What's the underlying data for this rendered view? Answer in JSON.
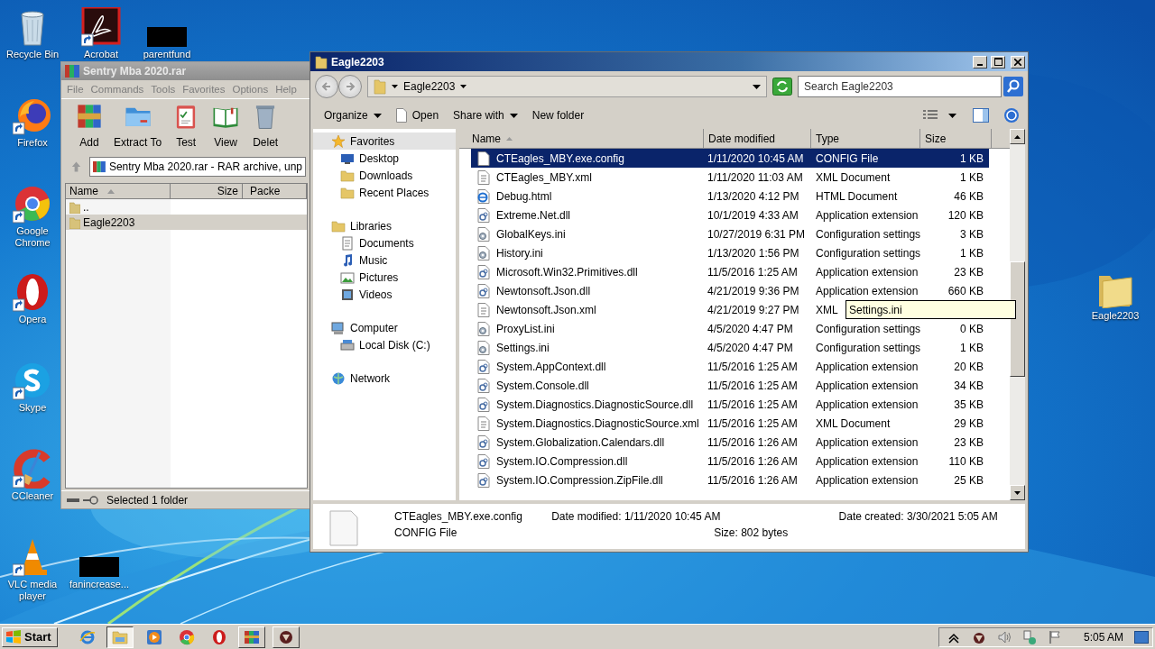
{
  "desktop": {
    "icons": [
      {
        "label": "Recycle Bin",
        "kind": "recycle",
        "shortcut": false
      },
      {
        "label": "Acrobat",
        "kind": "acrobat",
        "shortcut": true
      },
      {
        "label": "parentfund",
        "kind": "redacted",
        "shortcut": false
      },
      {
        "label": "Firefox",
        "kind": "firefox",
        "shortcut": true
      },
      {
        "label": "Google Chrome",
        "kind": "chrome",
        "shortcut": true
      },
      {
        "label": "Opera",
        "kind": "opera",
        "shortcut": true
      },
      {
        "label": "Skype",
        "kind": "skype",
        "shortcut": true
      },
      {
        "label": "CCleaner",
        "kind": "ccleaner",
        "shortcut": true
      },
      {
        "label": "VLC media player",
        "kind": "vlc",
        "shortcut": true
      },
      {
        "label": "fanincrease...",
        "kind": "redacted",
        "shortcut": false
      },
      {
        "label": "Eagle2203",
        "kind": "folder",
        "shortcut": false
      }
    ]
  },
  "winrar": {
    "title": "Sentry Mba 2020.rar",
    "menu": [
      "File",
      "Commands",
      "Tools",
      "Favorites",
      "Options",
      "Help"
    ],
    "toolbar": [
      {
        "label": "Add",
        "kind": "add"
      },
      {
        "label": "Extract To",
        "kind": "extract"
      },
      {
        "label": "Test",
        "kind": "test"
      },
      {
        "label": "View",
        "kind": "view"
      },
      {
        "label": "Delet",
        "kind": "delete"
      }
    ],
    "address": "Sentry Mba 2020.rar - RAR archive, unp",
    "columns": [
      {
        "label": "Name",
        "sorted": true
      },
      {
        "label": "Size",
        "sorted": false
      },
      {
        "label": "Packe",
        "sorted": false
      }
    ],
    "rows": [
      {
        "name": "..",
        "selected": false
      },
      {
        "name": "Eagle2203",
        "selected": true
      }
    ],
    "status": "Selected 1 folder"
  },
  "explorer": {
    "title": "Eagle2203",
    "breadcrumb": "Eagle2203",
    "search": {
      "placeholder": "Search Eagle2203"
    },
    "commands": [
      {
        "label": "Organize",
        "kind": "menu"
      },
      {
        "label": "Open",
        "kind": "icon"
      },
      {
        "label": "Share with",
        "kind": "menu"
      },
      {
        "label": "New folder",
        "kind": "plain"
      }
    ],
    "nav": [
      {
        "label": "Favorites",
        "kind": "star",
        "selected": true,
        "children": [
          {
            "label": "Desktop",
            "kind": "desktop",
            "selected": false
          },
          {
            "label": "Downloads",
            "kind": "downloads",
            "selected": false
          },
          {
            "label": "Recent Places",
            "kind": "recent",
            "selected": false
          }
        ]
      },
      {
        "label": "Libraries",
        "kind": "libraries",
        "selected": false,
        "children": [
          {
            "label": "Documents",
            "kind": "documents",
            "selected": false
          },
          {
            "label": "Music",
            "kind": "music",
            "selected": false
          },
          {
            "label": "Pictures",
            "kind": "pictures",
            "selected": false
          },
          {
            "label": "Videos",
            "kind": "videos",
            "selected": false
          }
        ]
      },
      {
        "label": "Computer",
        "kind": "computer",
        "selected": false,
        "children": [
          {
            "label": "Local Disk (C:)",
            "kind": "disk",
            "selected": false
          }
        ]
      },
      {
        "label": "Network",
        "kind": "network",
        "selected": false
      }
    ],
    "columns": [
      {
        "label": "Name",
        "sorted": true
      },
      {
        "label": "Date modified",
        "sorted": false
      },
      {
        "label": "Type",
        "sorted": false
      },
      {
        "label": "Size",
        "sorted": false
      }
    ],
    "rows": [
      {
        "name": "CTEagles_MBY.exe.config",
        "date": "1/11/2020 10:45 AM",
        "type": "CONFIG File",
        "size": "1 KB",
        "kind": "config",
        "selected": true
      },
      {
        "name": "CTEagles_MBY.xml",
        "date": "1/11/2020 11:03 AM",
        "type": "XML Document",
        "size": "1 KB",
        "kind": "xml",
        "selected": false
      },
      {
        "name": "Debug.html",
        "date": "1/13/2020 4:12 PM",
        "type": "HTML Document",
        "size": "46 KB",
        "kind": "html",
        "selected": false
      },
      {
        "name": "Extreme.Net.dll",
        "date": "10/1/2019 4:33 AM",
        "type": "Application extension",
        "size": "120 KB",
        "kind": "dll",
        "selected": false
      },
      {
        "name": "GlobalKeys.ini",
        "date": "10/27/2019 6:31 PM",
        "type": "Configuration settings",
        "size": "3 KB",
        "kind": "ini",
        "selected": false
      },
      {
        "name": "History.ini",
        "date": "1/13/2020 1:56 PM",
        "type": "Configuration settings",
        "size": "1 KB",
        "kind": "ini",
        "selected": false
      },
      {
        "name": "Microsoft.Win32.Primitives.dll",
        "date": "11/5/2016 1:25 AM",
        "type": "Application extension",
        "size": "23 KB",
        "kind": "dll",
        "selected": false
      },
      {
        "name": "Newtonsoft.Json.dll",
        "date": "4/21/2019 9:36 PM",
        "type": "Application extension",
        "size": "660 KB",
        "kind": "dll",
        "selected": false
      },
      {
        "name": "Newtonsoft.Json.xml",
        "date": "4/21/2019 9:27 PM",
        "type": "XML",
        "kind": "xml",
        "selected": false
      },
      {
        "name": "ProxyList.ini",
        "date": "4/5/2020 4:47 PM",
        "type": "Configuration settings",
        "size": "0 KB",
        "kind": "ini",
        "selected": false
      },
      {
        "name": "Settings.ini",
        "date": "4/5/2020 4:47 PM",
        "type": "Configuration settings",
        "size": "1 KB",
        "kind": "ini",
        "selected": false
      },
      {
        "name": "System.AppContext.dll",
        "date": "11/5/2016 1:25 AM",
        "type": "Application extension",
        "size": "20 KB",
        "kind": "dll",
        "selected": false
      },
      {
        "name": "System.Console.dll",
        "date": "11/5/2016 1:25 AM",
        "type": "Application extension",
        "size": "34 KB",
        "kind": "dll",
        "selected": false
      },
      {
        "name": "System.Diagnostics.DiagnosticSource.dll",
        "date": "11/5/2016 1:25 AM",
        "type": "Application extension",
        "size": "35 KB",
        "kind": "dll",
        "selected": false
      },
      {
        "name": "System.Diagnostics.DiagnosticSource.xml",
        "date": "11/5/2016 1:25 AM",
        "type": "XML Document",
        "size": "29 KB",
        "kind": "xml",
        "selected": false
      },
      {
        "name": "System.Globalization.Calendars.dll",
        "date": "11/5/2016 1:26 AM",
        "type": "Application extension",
        "size": "23 KB",
        "kind": "dll",
        "selected": false
      },
      {
        "name": "System.IO.Compression.dll",
        "date": "11/5/2016 1:26 AM",
        "type": "Application extension",
        "size": "110 KB",
        "kind": "dll",
        "selected": false
      },
      {
        "name": "System.IO.Compression.ZipFile.dll",
        "date": "11/5/2016 1:26 AM",
        "type": "Application extension",
        "size": "25 KB",
        "kind": "dll",
        "selected": false
      }
    ],
    "tooltip": "Settings.ini",
    "details": {
      "name": "CTEagles_MBY.exe.config",
      "type": "CONFIG File",
      "fields": [
        {
          "label": "Date modified:",
          "value": "1/11/2020 10:45 AM"
        },
        {
          "label": "Size:",
          "value": "802 bytes"
        },
        {
          "label": "Date created:",
          "value": "3/30/2021 5:05 AM"
        }
      ]
    }
  },
  "taskbar": {
    "start": "Start",
    "items": [
      {
        "kind": "ie",
        "active": false,
        "running": false
      },
      {
        "kind": "explorer",
        "active": true,
        "running": true
      },
      {
        "kind": "media",
        "active": false,
        "running": false
      },
      {
        "kind": "chrome",
        "active": false,
        "running": false
      },
      {
        "kind": "opera",
        "active": false,
        "running": false
      },
      {
        "kind": "winrar",
        "active": false,
        "running": true
      },
      {
        "kind": "app",
        "active": false,
        "running": true
      }
    ],
    "tray": {
      "time": "5:05 AM"
    }
  }
}
